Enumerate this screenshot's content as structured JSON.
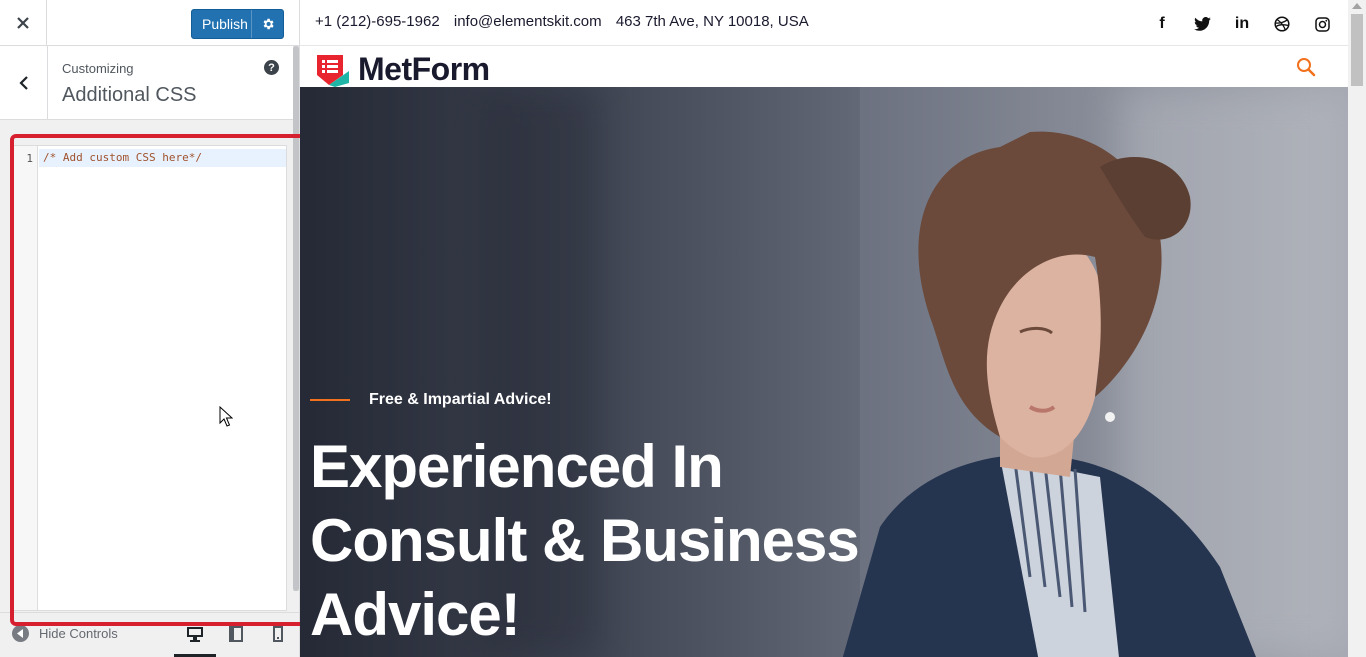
{
  "sidebar": {
    "publish_label": "Publish",
    "customizing_label": "Customizing",
    "section_title": "Additional CSS",
    "help_glyph": "?",
    "editor": {
      "line_number": "1",
      "code": "/* Add custom CSS here*/"
    },
    "footer": {
      "hide_controls_label": "Hide Controls",
      "active_device": "desktop"
    }
  },
  "preview": {
    "topbar": {
      "phone": "+1 (212)-695-1962",
      "email": "info@elementskit.com",
      "address": "463 7th Ave, NY 10018, USA"
    },
    "socials": [
      {
        "icon": "facebook-icon",
        "glyph": "f"
      },
      {
        "icon": "twitter-icon",
        "glyph": "🐦"
      },
      {
        "icon": "linkedin-icon",
        "glyph": "in"
      },
      {
        "icon": "dribbble-icon",
        "glyph": "⊛"
      },
      {
        "icon": "instagram-icon",
        "glyph": "◎"
      }
    ],
    "logo_text": "MetForm",
    "hero": {
      "tagline": "Free & Impartial Advice!",
      "title_line1": "Experienced In",
      "title_line2": "Consult & Business",
      "title_line3": "Advice!"
    }
  },
  "colors": {
    "publish": "#2271b1",
    "highlight": "#d6202f",
    "accent_orange": "#f2711c"
  }
}
